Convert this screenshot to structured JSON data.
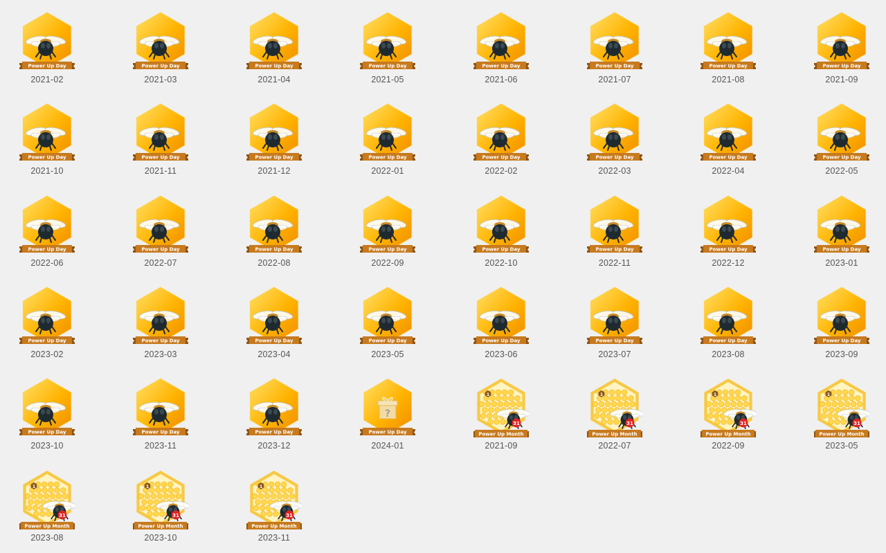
{
  "badge_ribbon_day": "Power Up Day",
  "badge_ribbon_month": "Power Up Month",
  "mystery_symbol": "?",
  "streak_number": "31",
  "level_number": "1",
  "colors": {
    "page_bg": "#f0f0f0",
    "hex_light": "#ffe066",
    "hex_mid": "#ffb300",
    "hex_dark": "#f08c00",
    "ribbon": "#c77a1e",
    "ribbon_dark": "#8f5412",
    "bee_body": "#1f2a30",
    "streak_red": "#e02424",
    "caption": "#555555"
  },
  "badges": [
    {
      "type": "day",
      "date": "2021-02"
    },
    {
      "type": "day",
      "date": "2021-03"
    },
    {
      "type": "day",
      "date": "2021-04"
    },
    {
      "type": "day",
      "date": "2021-05"
    },
    {
      "type": "day",
      "date": "2021-06"
    },
    {
      "type": "day",
      "date": "2021-07"
    },
    {
      "type": "day",
      "date": "2021-08"
    },
    {
      "type": "day",
      "date": "2021-09"
    },
    {
      "type": "day",
      "date": "2021-10"
    },
    {
      "type": "day",
      "date": "2021-11"
    },
    {
      "type": "day",
      "date": "2021-12"
    },
    {
      "type": "day",
      "date": "2022-01"
    },
    {
      "type": "day",
      "date": "2022-02"
    },
    {
      "type": "day",
      "date": "2022-03"
    },
    {
      "type": "day",
      "date": "2022-04"
    },
    {
      "type": "day",
      "date": "2022-05"
    },
    {
      "type": "day",
      "date": "2022-06"
    },
    {
      "type": "day",
      "date": "2022-07"
    },
    {
      "type": "day",
      "date": "2022-08"
    },
    {
      "type": "day",
      "date": "2022-09"
    },
    {
      "type": "day",
      "date": "2022-10"
    },
    {
      "type": "day",
      "date": "2022-11"
    },
    {
      "type": "day",
      "date": "2022-12"
    },
    {
      "type": "day",
      "date": "2023-01"
    },
    {
      "type": "day",
      "date": "2023-02"
    },
    {
      "type": "day",
      "date": "2023-03"
    },
    {
      "type": "day",
      "date": "2023-04"
    },
    {
      "type": "day",
      "date": "2023-05"
    },
    {
      "type": "day",
      "date": "2023-06"
    },
    {
      "type": "day",
      "date": "2023-07"
    },
    {
      "type": "day",
      "date": "2023-08"
    },
    {
      "type": "day",
      "date": "2023-09"
    },
    {
      "type": "day",
      "date": "2023-10"
    },
    {
      "type": "day",
      "date": "2023-11"
    },
    {
      "type": "day",
      "date": "2023-12"
    },
    {
      "type": "mystery",
      "date": "2024-01"
    },
    {
      "type": "month",
      "date": "2021-09"
    },
    {
      "type": "month",
      "date": "2022-07"
    },
    {
      "type": "month",
      "date": "2022-09"
    },
    {
      "type": "month",
      "date": "2023-05"
    },
    {
      "type": "month",
      "date": "2023-08"
    },
    {
      "type": "month",
      "date": "2023-10"
    },
    {
      "type": "month",
      "date": "2023-11"
    }
  ]
}
